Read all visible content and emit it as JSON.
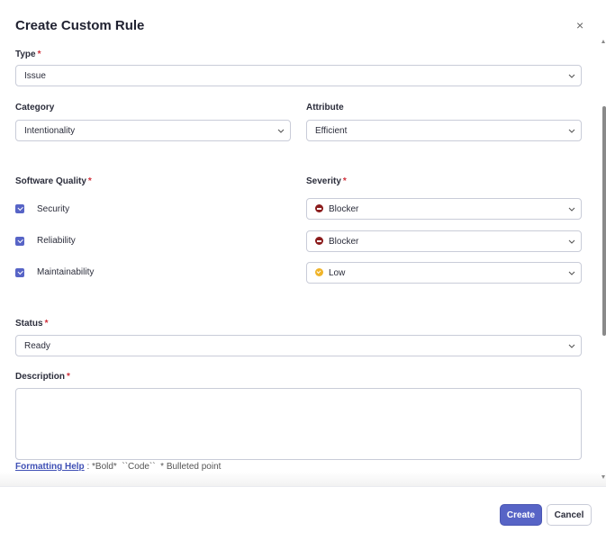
{
  "modal": {
    "title": "Create Custom Rule",
    "close_icon": "×"
  },
  "fields": {
    "type": {
      "label": "Type",
      "required": "*",
      "value": "Issue"
    },
    "category": {
      "label": "Category",
      "value": "Intentionality"
    },
    "attribute": {
      "label": "Attribute",
      "value": "Efficient"
    },
    "software_quality": {
      "label": "Software Quality",
      "required": "*"
    },
    "severity": {
      "label": "Severity",
      "required": "*"
    },
    "qualities": [
      {
        "label": "Security",
        "checked": true,
        "severity": "Blocker",
        "severity_icon": "blocker-icon"
      },
      {
        "label": "Reliability",
        "checked": true,
        "severity": "Blocker",
        "severity_icon": "blocker-icon"
      },
      {
        "label": "Maintainability",
        "checked": true,
        "severity": "Low",
        "severity_icon": "low-icon"
      }
    ],
    "status": {
      "label": "Status",
      "required": "*",
      "value": "Ready"
    },
    "description": {
      "label": "Description",
      "required": "*",
      "value": ""
    }
  },
  "help": {
    "link": "Formatting Help",
    "separator": ":",
    "text": "*Bold*  ``Code``  * Bulleted point"
  },
  "footer": {
    "create_label": "Create",
    "cancel_label": "Cancel"
  },
  "colors": {
    "accent": "#5764c6",
    "required": "#d02f3a",
    "blocker": "#8b1c1c",
    "low": "#f0b429",
    "border": "#c9ccd8"
  }
}
